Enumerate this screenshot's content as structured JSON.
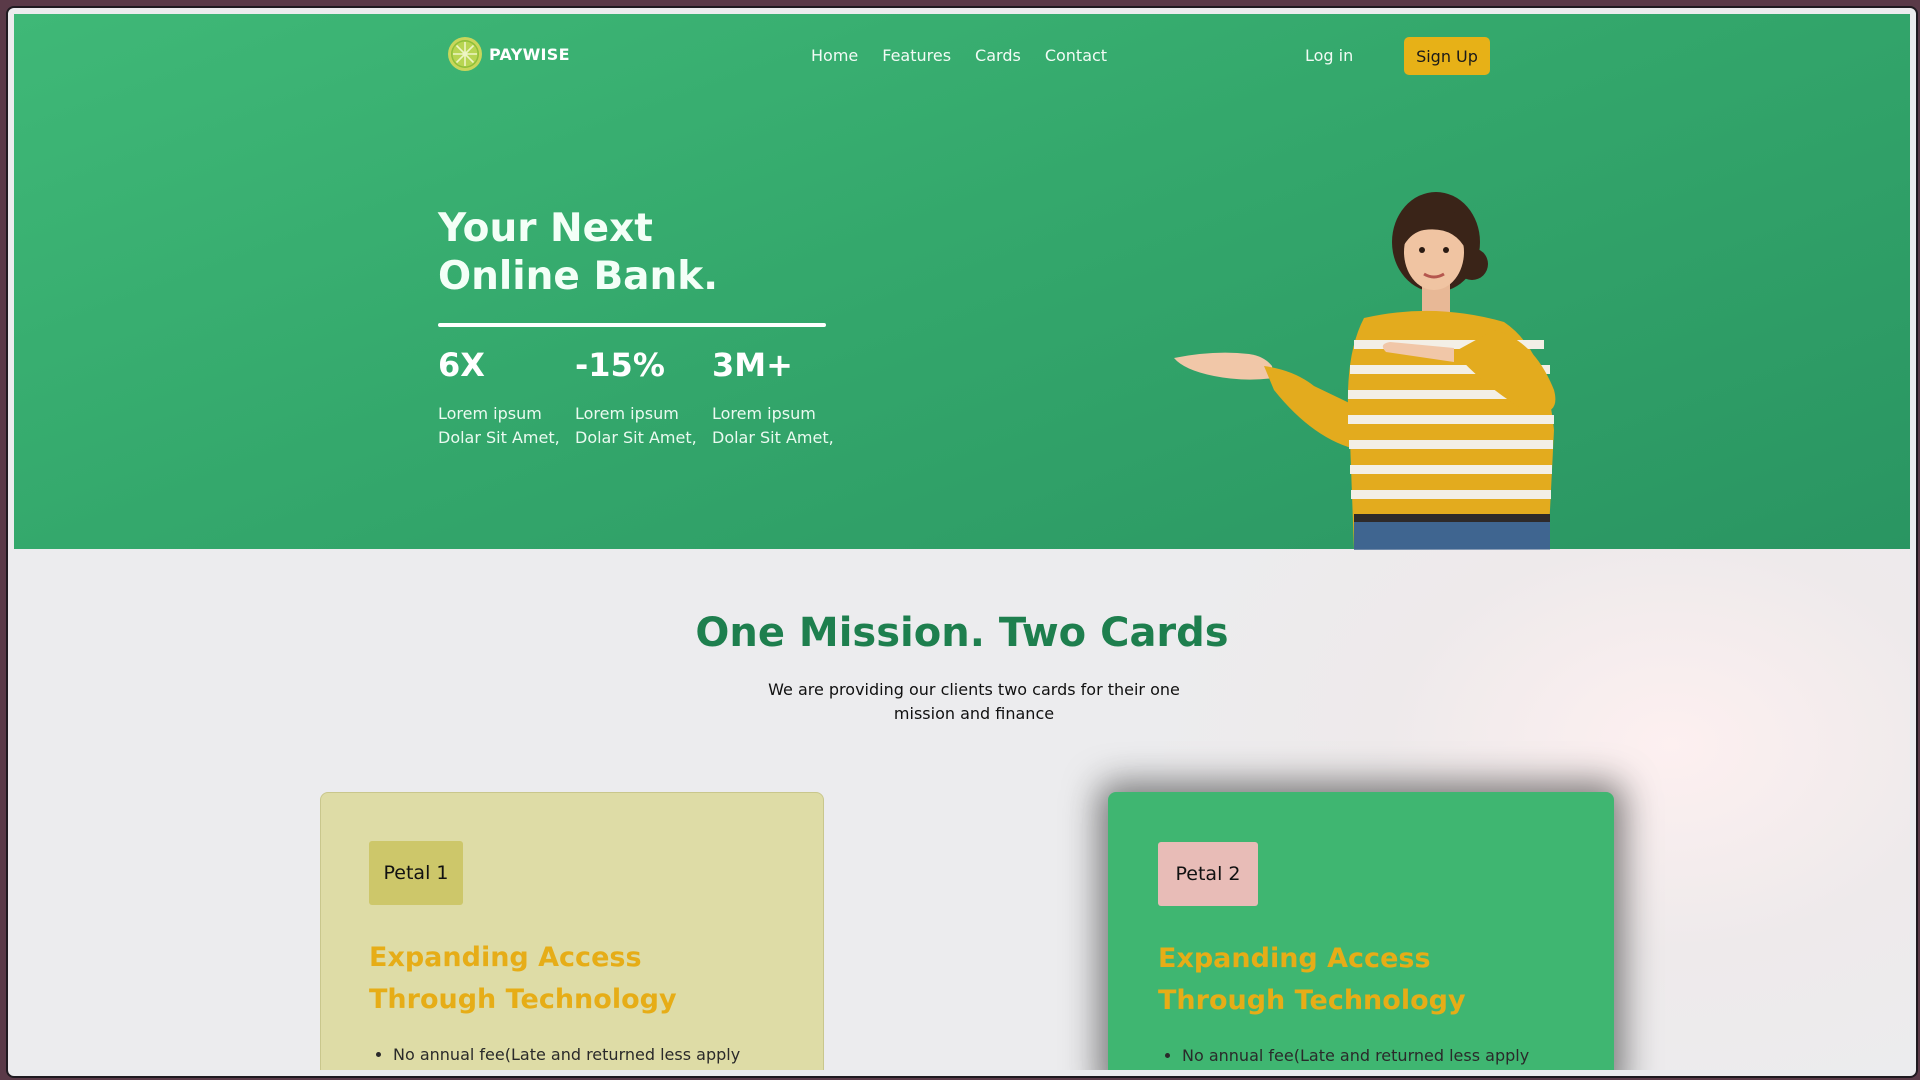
{
  "colors": {
    "hero_green": "#3fb877",
    "accent_yellow": "#e7b117",
    "mission_green": "#1e7f4e",
    "card1_bg": "#dedca6",
    "card2_bg": "#3fb671",
    "petal1_bg": "#cdc76a",
    "petal2_bg": "#e8bcb7"
  },
  "nav": {
    "brand": "PAYWISE",
    "logo_icon": "lime-slice-icon",
    "links": [
      "Home",
      "Features",
      "Cards",
      "Contact"
    ],
    "login": "Log in",
    "signup": "Sign Up"
  },
  "hero": {
    "title_line1": "Your Next",
    "title_line2": "Online Bank.",
    "stats": [
      {
        "value": "6X",
        "desc_line1": "Lorem ipsum",
        "desc_line2": "Dolar Sit Amet,"
      },
      {
        "value": "-15%",
        "desc_line1": "Lorem ipsum",
        "desc_line2": "Dolar Sit Amet,"
      },
      {
        "value": "3M+",
        "desc_line1": "Lorem ipsum",
        "desc_line2": "Dolar Sit Amet,"
      }
    ],
    "image": "woman-presenting-illustration"
  },
  "mission": {
    "title": "One Mission. Two Cards",
    "subtitle": "We are providing our clients two cards for their one mission and finance"
  },
  "cards": [
    {
      "badge": "Petal 1",
      "title_line1": "Expanding Access",
      "title_line2": "Through Technology",
      "bullets": [
        "No annual fee(Late and returned less apply"
      ]
    },
    {
      "badge": "Petal 2",
      "title_line1": "Expanding Access",
      "title_line2": "Through Technology",
      "bullets": [
        "No annual fee(Late and returned less apply"
      ]
    }
  ]
}
